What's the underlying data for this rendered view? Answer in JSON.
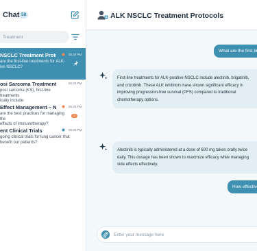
{
  "sidebar": {
    "title": "Chats",
    "count": "58",
    "search_placeholder": "Treatment",
    "chats": [
      {
        "title": "NSCLC Treatment Protocols",
        "preview": "are the first-line treatments for ALK-\nive NSCLC?",
        "time": "05:20 PM",
        "active": true
      },
      {
        "title": "osi Sarcoma Treatment…",
        "preview": "posi sarcoma (KS), first-line treatments\nically include:",
        "time": "05:20 PM",
        "active": false
      },
      {
        "title": "Effect Management – NSCLC",
        "preview": "are the best practices for managing the\neffects of immunotherapy?",
        "time": "05:20 PM",
        "active": false,
        "badge": "2"
      },
      {
        "title": "ent Clinical Trials",
        "preview": "going clinical trials for lung cancer that\nbenefit our patients?",
        "time": "05:20 PM",
        "active": false
      }
    ]
  },
  "main": {
    "title": "ALK NSCLC Treatment Protocols",
    "messages": [
      {
        "role": "user",
        "text": "What are the first-line"
      },
      {
        "role": "ai",
        "text": "First-line treatments for ALK-positive NSCLC include alectinib, brigatinib, and crizotinib. These ALK inhibitors have shown significant efficacy in improving progression-free survival (PFS) compared to traditional chemotherapy options."
      },
      {
        "role": "ai",
        "text": "Alectinib is typically administered at a dose of 600 mg taken orally twice daily. This dosage has been shown to maximize efficacy while managing side effects effectively."
      },
      {
        "role": "user",
        "text": "How effective"
      }
    ],
    "composer_placeholder": "Enter your message here"
  },
  "colors": {
    "accent": "#3f8fb1",
    "ai_bubble": "#e2eef4",
    "main_bg": "#f3f8fa",
    "badge_orange": "#f08a52"
  }
}
